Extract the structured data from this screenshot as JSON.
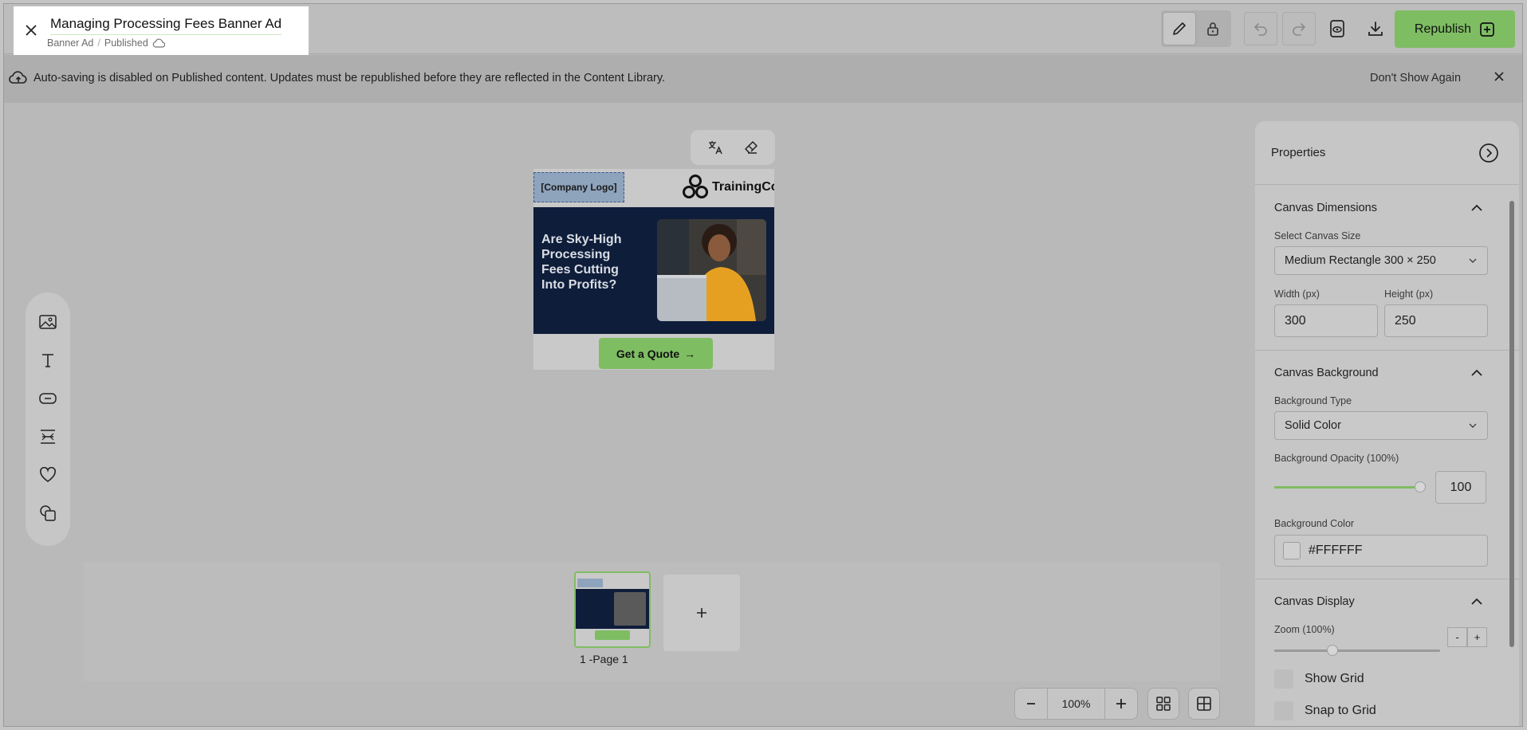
{
  "header": {
    "doc_title": "Managing Processing Fees Banner Ad",
    "doc_type": "Banner Ad",
    "status": "Published",
    "republish_label": "Republish"
  },
  "notice": {
    "message": "Auto-saving is disabled on Published content. Updates must be republished before they are reflected in the Content Library.",
    "dont_show": "Don't Show Again"
  },
  "ad": {
    "logo_placeholder": "[Company Logo]",
    "brand": "TrainingCo",
    "headline": "Are Sky-High Processing Fees Cutting Into Profits?",
    "cta": "Get a Quote",
    "cta_arrow": "→"
  },
  "pages": {
    "thumb_label": "1 -Page 1",
    "add_symbol": "+"
  },
  "zoom": {
    "value": "100%",
    "minus": "−",
    "plus": "+"
  },
  "properties": {
    "title": "Properties",
    "canvas_dimensions": {
      "title": "Canvas Dimensions",
      "size_label": "Select Canvas Size",
      "size_value": "Medium Rectangle 300 × 250",
      "width_label": "Width (px)",
      "width_value": "300",
      "height_label": "Height (px)",
      "height_value": "250"
    },
    "canvas_background": {
      "title": "Canvas Background",
      "type_label": "Background Type",
      "type_value": "Solid Color",
      "opacity_label": "Background Opacity (100%)",
      "opacity_value": "100",
      "opacity_fraction": 1.0,
      "color_label": "Background Color",
      "color_value": "#FFFFFF"
    },
    "canvas_display": {
      "title": "Canvas Display",
      "zoom_label": "Zoom (100%)",
      "zoom_fraction": 0.35,
      "minus": "-",
      "plus": "+",
      "show_grid": "Show Grid",
      "snap_grid": "Snap to Grid"
    }
  },
  "colors": {
    "accent": "#7fbd63",
    "hero_bg": "#0e1d3a"
  },
  "icons": {
    "close": "close-icon",
    "edit": "pencil-icon",
    "lock": "lock-icon",
    "undo": "undo-icon",
    "redo": "redo-icon",
    "preview": "preview-icon",
    "download": "download-icon"
  }
}
